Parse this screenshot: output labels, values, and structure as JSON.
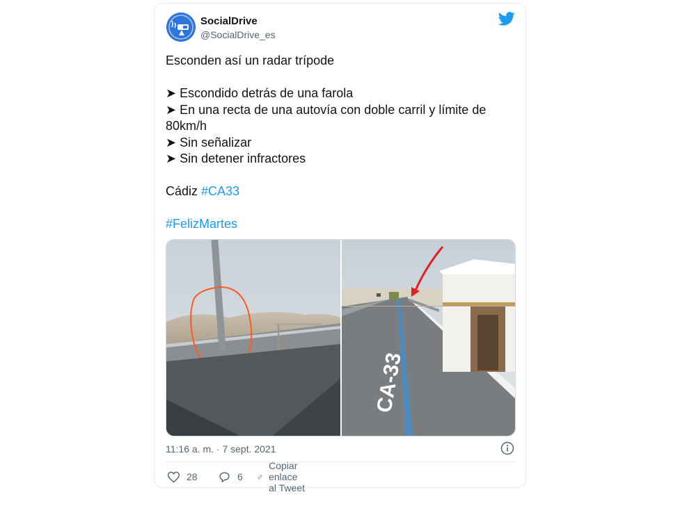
{
  "tweet": {
    "author": {
      "display_name": "SocialDrive",
      "handle": "@SocialDrive_es"
    },
    "lines": [
      "Esconden así un radar trípode",
      "",
      "➤ Escondido detrás de una farola",
      "➤ En una recta de una autovía con doble carril y límite de",
      "80km/h",
      "➤ Sin señalizar",
      "➤ Sin detener infractores",
      "",
      "Cádiz "
    ],
    "hashtag_inline": "#CA33",
    "hashtag_standalone": "#FelizMartes",
    "timestamp": "11:16 a. m. · 7 sept. 2021",
    "media": {
      "right_road_label": "CA-33"
    },
    "actions": {
      "likes": "28",
      "replies": "6",
      "copy_link_label": "Copiar enlace al Tweet"
    }
  },
  "colors": {
    "accent": "#1d9bf0",
    "muted": "#536471",
    "border": "#e6ecf0"
  },
  "icons": [
    "socialdrive-logo-icon",
    "twitter-bird-icon",
    "info-icon",
    "heart-icon",
    "reply-icon",
    "link-icon"
  ]
}
